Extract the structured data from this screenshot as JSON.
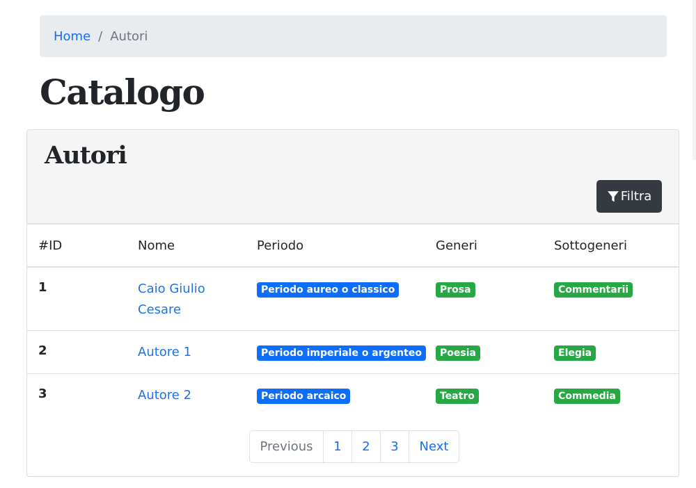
{
  "breadcrumb": {
    "home": "Home",
    "separator": "/",
    "current": "Autori"
  },
  "page_title": "Catalogo",
  "card": {
    "title": "Autori",
    "filter_label": "Filtra"
  },
  "table": {
    "headers": [
      "#ID",
      "Nome",
      "Periodo",
      "Generi",
      "Sottogeneri"
    ],
    "rows": [
      {
        "id": "1",
        "name": "Caio Giulio Cesare",
        "periodo": "Periodo aureo o classico",
        "genere": "Prosa",
        "sottogenere": "Commentarii"
      },
      {
        "id": "2",
        "name": "Autore 1",
        "periodo": "Periodo imperiale o argenteo",
        "genere": "Poesia",
        "sottogenere": "Elegia"
      },
      {
        "id": "3",
        "name": "Autore 2",
        "periodo": "Periodo arcaico",
        "genere": "Teatro",
        "sottogenere": "Commedia"
      }
    ]
  },
  "pagination": {
    "previous": "Previous",
    "pages": [
      "1",
      "2",
      "3"
    ],
    "next": "Next"
  },
  "colors": {
    "primary": "#0d6efd",
    "success": "#28a745",
    "dark": "#343a40",
    "breadcrumb_bg": "#e9ecef"
  }
}
